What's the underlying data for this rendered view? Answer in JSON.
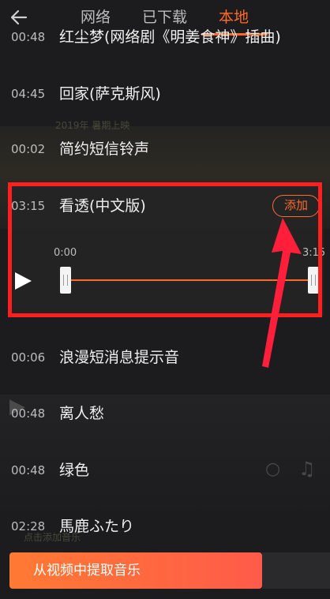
{
  "header": {
    "tabs": [
      {
        "label": "网络",
        "active": false
      },
      {
        "label": "已下载",
        "active": false
      },
      {
        "label": "本地",
        "active": true
      }
    ]
  },
  "ghost_texts": {
    "line1": "2019年 暑期上映",
    "line2": "点击添加音乐"
  },
  "songs": [
    {
      "time": "00:48",
      "title": "红尘梦(网络剧《明姜食神》插曲)"
    },
    {
      "time": "04:45",
      "title": "回家(萨克斯风)"
    },
    {
      "time": "00:02",
      "title": "简约短信铃声"
    },
    {
      "time": "03:15",
      "title": "看透(中文版)",
      "expanded": true
    },
    {
      "time": "00:06",
      "title": "浪漫短消息提示音"
    },
    {
      "time": "00:48",
      "title": "离人愁"
    },
    {
      "time": "00:48",
      "title": "绿色"
    },
    {
      "time": "02:28",
      "title": "馬鹿ふたり"
    }
  ],
  "player": {
    "add_label": "添加",
    "start_time": "0:00",
    "end_time": "3:15"
  },
  "bottom": {
    "extract_label": "从视频中提取音乐"
  },
  "colors": {
    "accent": "#ff6a2b",
    "highlight": "#ff1f1f",
    "background": "#1c1c1e"
  }
}
